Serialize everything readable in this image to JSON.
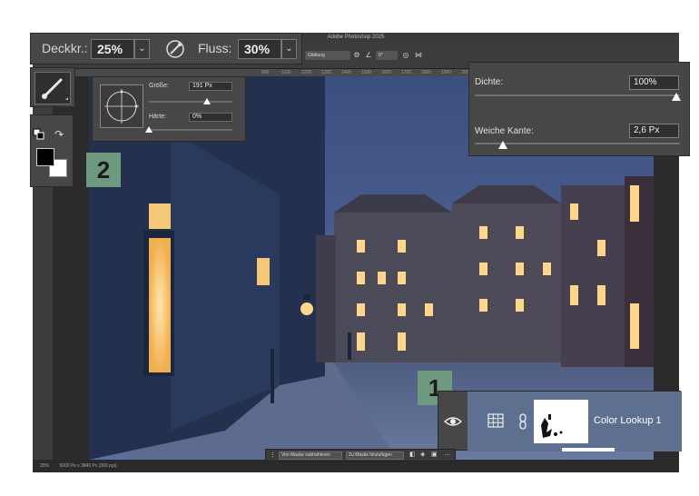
{
  "window": {
    "title": "Adobe Photoshop 2025"
  },
  "options_bar": {
    "opacity_label": "Deckkr.:",
    "opacity_value": "25%",
    "flow_label": "Fluss:",
    "flow_value": "30%",
    "smoothing_label": "Glättung",
    "angle_value": "0°"
  },
  "ruler": {
    "ticks": [
      "800",
      "1100",
      "1200",
      "1300",
      "1400",
      "1500",
      "1600",
      "1700",
      "1800",
      "1900",
      "2000",
      "2100",
      "2200",
      "2300",
      "2400",
      "2500"
    ]
  },
  "brush_popup": {
    "size_label": "Größe:",
    "size_value": "191 Px",
    "hardness_label": "Härte:",
    "hardness_value": "0%"
  },
  "density_panel": {
    "density_label": "Dichte:",
    "density_value": "100%",
    "feather_label": "Weiche Kante:",
    "feather_value": "2,6 Px"
  },
  "badges": {
    "one": "1",
    "two": "2"
  },
  "layer": {
    "name": "Color Lookup 1"
  },
  "mask_bar": {
    "subtract": "Von Maske subtrahieren",
    "add": "Zu Maske hinzufügen"
  },
  "status_bar": {
    "zoom": "25%",
    "doc_info": "5000 Px x 3840 Px (300 ppi)"
  },
  "colors": {
    "accent_badge": "#6d9a7e",
    "layer_selected": "#5d7090",
    "panel_bg": "#474747",
    "night_sky": "#3f5383",
    "window_glow": "#ffd58a"
  },
  "icons": {
    "brush_tool": "brush-icon",
    "airbrush": "airbrush-icon",
    "visibility": "eye-icon",
    "adjustment": "grid-icon",
    "link": "chain-icon",
    "swap_colors": "swap-icon",
    "default_colors": "default-colors-icon"
  }
}
